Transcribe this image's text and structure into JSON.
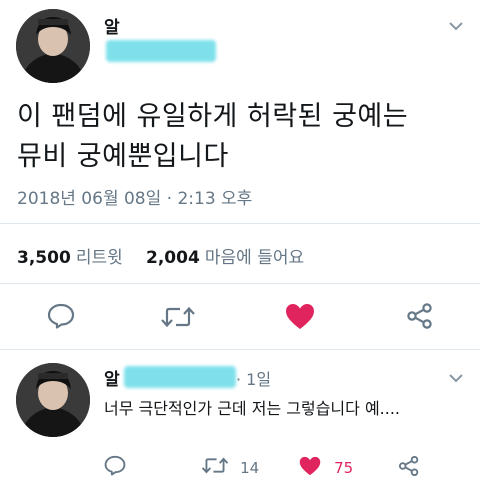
{
  "tweet": {
    "author_name": "알",
    "text_line1": "이 팬덤에 유일하게 허락된 궁예는",
    "text_line2": "뮤비 궁예뿐입니다",
    "timestamp": "2018년 06월 08일 · 2:13 오후",
    "retweets_count": "3,500",
    "retweets_label": "리트윗",
    "likes_count": "2,004",
    "likes_label": "마음에 들어요",
    "liked": true
  },
  "reply": {
    "author_name": "알",
    "time": "· 1일",
    "text": "너무 극단적인가 근데 저는 그렇습니다 예....",
    "retweet_count": "14",
    "like_count": "75"
  },
  "icons": {
    "reply": "reply-icon",
    "retweet": "retweet-icon",
    "like": "heart-icon",
    "share": "share-icon",
    "menu": "chevron-down-icon"
  },
  "colors": {
    "like_red": "#e0245e",
    "muted": "#657786",
    "icon": "#657786",
    "redaction": "#7fe0ec"
  }
}
